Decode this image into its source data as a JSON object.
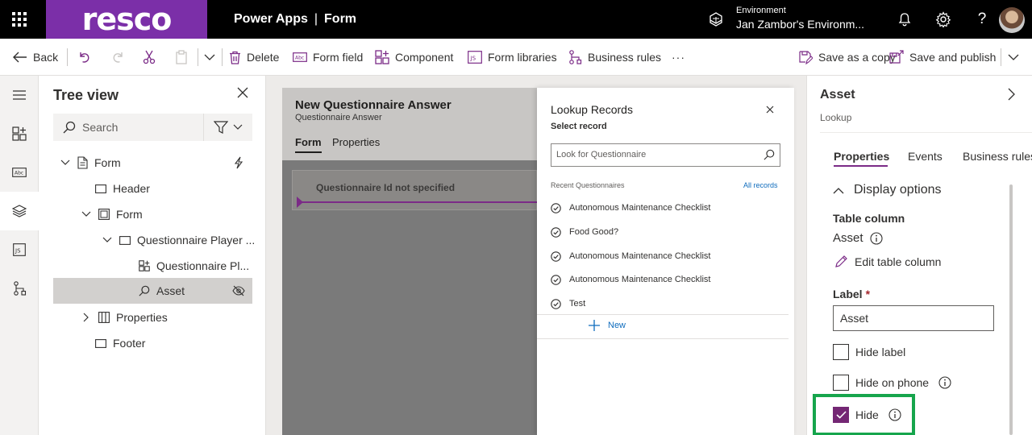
{
  "topbar": {
    "brand": "resco",
    "app": "Power Apps",
    "separator": "|",
    "page": "Form",
    "env_label": "Environment",
    "env_name": "Jan Zambor's Environm..."
  },
  "toolbar": {
    "back": "Back",
    "delete": "Delete",
    "form_field": "Form field",
    "component": "Component",
    "form_libraries": "Form libraries",
    "business_rules": "Business rules",
    "more": "···",
    "save_copy": "Save as a copy",
    "save_publish": "Save and publish"
  },
  "tree": {
    "title": "Tree view",
    "search_placeholder": "Search",
    "nodes": [
      {
        "label": "Form"
      },
      {
        "label": "Header"
      },
      {
        "label": "Form"
      },
      {
        "label": "Questionnaire Player ..."
      },
      {
        "label": "Questionnaire Pl..."
      },
      {
        "label": "Asset"
      },
      {
        "label": "Properties"
      },
      {
        "label": "Footer"
      }
    ]
  },
  "form": {
    "title": "New Questionnaire Answer",
    "subtitle": "Questionnaire Answer",
    "tabs": [
      "Form",
      "Properties"
    ],
    "card_text": "Questionnaire Id not specified"
  },
  "lookup": {
    "title": "Lookup Records",
    "subtitle": "Select record",
    "placeholder": "Look for Questionnaire",
    "recent_label": "Recent Questionnaires",
    "all_records": "All records",
    "items": [
      "Autonomous Maintenance Checklist",
      "Food Good?",
      "Autonomous Maintenance Checklist",
      "Autonomous Maintenance Checklist",
      "Test"
    ],
    "new_label": "New"
  },
  "panel": {
    "title": "Asset",
    "subtitle": "Lookup",
    "tabs": [
      "Properties",
      "Events",
      "Business rules"
    ],
    "section": "Display options",
    "table_column_label": "Table column",
    "table_column_value": "Asset",
    "edit_table_column": "Edit table column",
    "label_label": "Label",
    "required_mark": "*",
    "label_value": "Asset",
    "hide_label": "Hide label",
    "hide_on_phone": "Hide on phone",
    "hide": "Hide",
    "hide_checked": true
  },
  "colors": {
    "brand": "#7b2fa8",
    "accent": "#742774",
    "highlight": "#16a54c",
    "link": "#0f6cbd"
  }
}
